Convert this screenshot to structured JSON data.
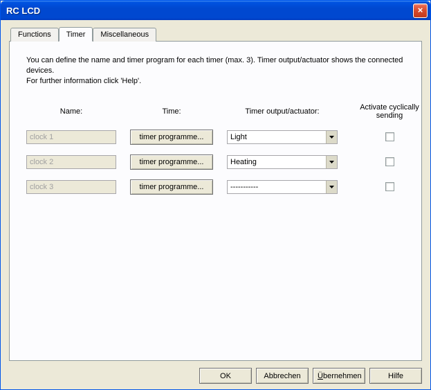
{
  "window": {
    "title": "RC LCD"
  },
  "tabs": [
    {
      "label": "Functions"
    },
    {
      "label": "Timer"
    },
    {
      "label": "Miscellaneous"
    }
  ],
  "intro": {
    "line1": "You can define the name and timer program for each timer (max. 3). Timer output/actuator shows the connected devices.",
    "line2": "For further information click 'Help'."
  },
  "headers": {
    "name": "Name:",
    "time": "Time:",
    "output": "Timer output/actuator:",
    "activate": "Activate cyclically sending"
  },
  "rows": [
    {
      "name": "clock 1",
      "time_btn": "timer programme...",
      "output": "Light"
    },
    {
      "name": "clock 2",
      "time_btn": "timer programme...",
      "output": "Heating"
    },
    {
      "name": "clock 3",
      "time_btn": "timer programme...",
      "output": "-----------"
    }
  ],
  "buttons": {
    "ok": "OK",
    "cancel": "Abbrechen",
    "apply_pre": "Ü",
    "apply_post": "bernehmen",
    "help": "Hilfe"
  }
}
